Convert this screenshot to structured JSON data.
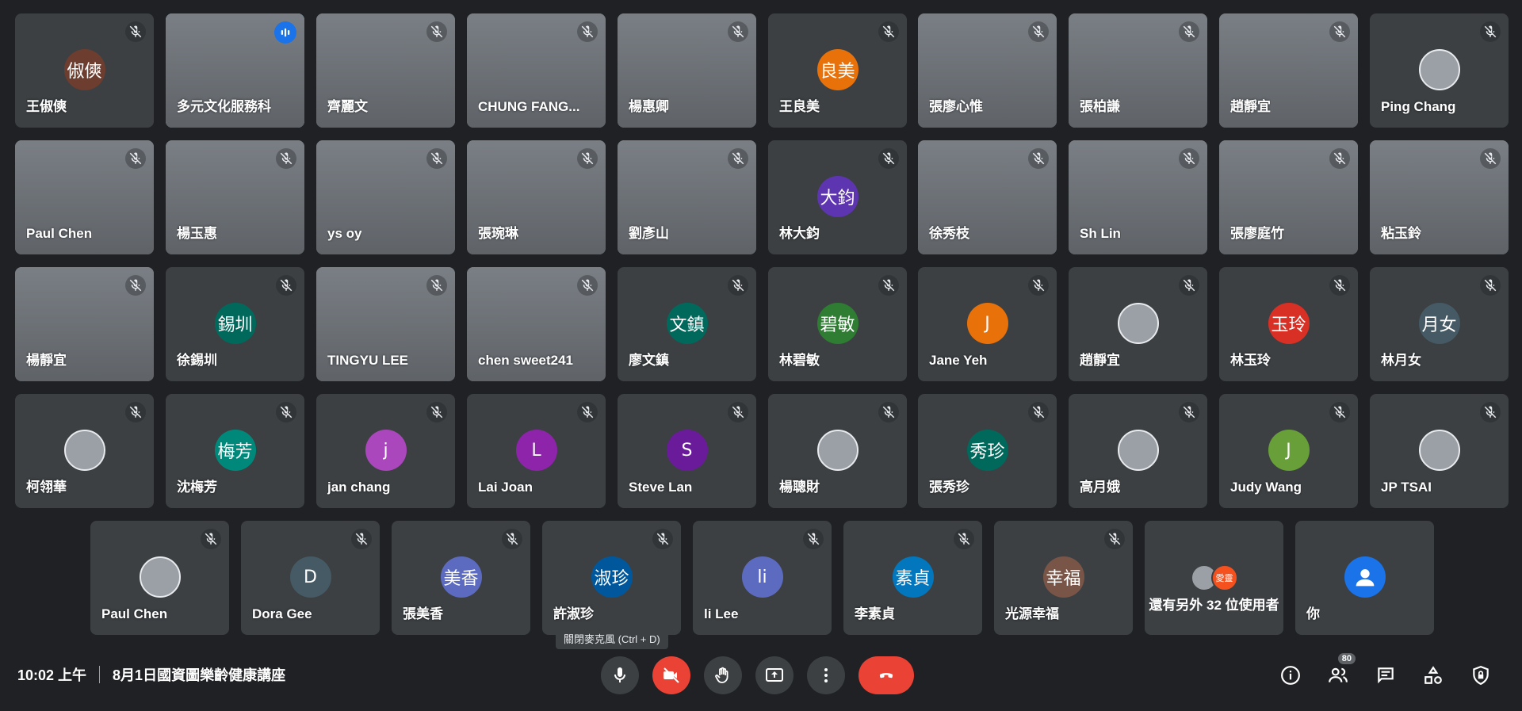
{
  "colors": {
    "background": "#202124",
    "tile": "#3c4043",
    "accent": "#8ab4f8",
    "danger": "#ea4335"
  },
  "participants": [
    {
      "name": "王俶傸",
      "avatar_text": "俶傸",
      "avatar_color": "#6d3d2f",
      "type": "initials"
    },
    {
      "name": "多元文化服務科",
      "type": "video",
      "speaking": true
    },
    {
      "name": "齊麗文",
      "type": "video"
    },
    {
      "name": "CHUNG FANG...",
      "type": "video"
    },
    {
      "name": "楊惠卿",
      "type": "video"
    },
    {
      "name": "王良美",
      "avatar_text": "良美",
      "avatar_color": "#e8710a",
      "type": "initials"
    },
    {
      "name": "張廖心惟",
      "type": "video"
    },
    {
      "name": "張柏謙",
      "type": "video"
    },
    {
      "name": "趙靜宜",
      "type": "video"
    },
    {
      "name": "Ping Chang",
      "type": "photo"
    },
    {
      "name": "Paul Chen",
      "type": "video"
    },
    {
      "name": "楊玉惠",
      "type": "video"
    },
    {
      "name": "ys oy",
      "type": "video"
    },
    {
      "name": "張琬琳",
      "type": "video"
    },
    {
      "name": "劉彥山",
      "type": "video"
    },
    {
      "name": "林大鈞",
      "avatar_text": "大鈞",
      "avatar_color": "#5e35b1",
      "type": "initials"
    },
    {
      "name": "徐秀枝",
      "type": "video"
    },
    {
      "name": "Sh Lin",
      "type": "video"
    },
    {
      "name": "張廖庭竹",
      "type": "video"
    },
    {
      "name": "粘玉鈴",
      "type": "video"
    },
    {
      "name": "楊靜宜",
      "type": "video"
    },
    {
      "name": "徐錫圳",
      "avatar_text": "錫圳",
      "avatar_color": "#00695c",
      "type": "initials"
    },
    {
      "name": "TINGYU LEE",
      "type": "video"
    },
    {
      "name": "chen sweet241",
      "type": "video"
    },
    {
      "name": "廖文鎮",
      "avatar_text": "文鎮",
      "avatar_color": "#00695c",
      "type": "initials"
    },
    {
      "name": "林碧敏",
      "avatar_text": "碧敏",
      "avatar_color": "#2e7d32",
      "type": "initials"
    },
    {
      "name": "Jane Yeh",
      "avatar_text": "J",
      "avatar_color": "#e8710a",
      "type": "initials"
    },
    {
      "name": "趙靜宜",
      "type": "photo"
    },
    {
      "name": "林玉玲",
      "avatar_text": "玉玲",
      "avatar_color": "#d93025",
      "type": "initials"
    },
    {
      "name": "林月女",
      "avatar_text": "月女",
      "avatar_color": "#455a64",
      "type": "initials"
    },
    {
      "name": "柯翎華",
      "type": "photo"
    },
    {
      "name": "沈梅芳",
      "avatar_text": "梅芳",
      "avatar_color": "#00897b",
      "type": "initials"
    },
    {
      "name": "jan chang",
      "avatar_text": "j",
      "avatar_color": "#ab47bc",
      "type": "initials"
    },
    {
      "name": "Lai Joan",
      "avatar_text": "L",
      "avatar_color": "#8e24aa",
      "type": "initials"
    },
    {
      "name": "Steve Lan",
      "avatar_text": "S",
      "avatar_color": "#6a1b9a",
      "type": "initials"
    },
    {
      "name": "楊聰財",
      "type": "photo"
    },
    {
      "name": "張秀珍",
      "avatar_text": "秀珍",
      "avatar_color": "#00695c",
      "type": "initials"
    },
    {
      "name": "高月娥",
      "type": "photo"
    },
    {
      "name": "Judy Wang",
      "avatar_text": "J",
      "avatar_color": "#689f38",
      "type": "initials"
    },
    {
      "name": "JP TSAI",
      "type": "photo"
    },
    {
      "name": "Paul Chen",
      "type": "photo"
    },
    {
      "name": "Dora Gee",
      "avatar_text": "D",
      "avatar_color": "#455a64",
      "type": "initials"
    },
    {
      "name": "張美香",
      "avatar_text": "美香",
      "avatar_color": "#5c6bc0",
      "type": "initials"
    },
    {
      "name": "許淑珍",
      "avatar_text": "淑珍",
      "avatar_color": "#01579b",
      "type": "initials"
    },
    {
      "name": "li Lee",
      "avatar_text": "li",
      "avatar_color": "#5c6bc0",
      "type": "initials"
    },
    {
      "name": "李素貞",
      "avatar_text": "素貞",
      "avatar_color": "#0277bd",
      "type": "initials"
    },
    {
      "name": "光源幸福",
      "avatar_text": "幸福",
      "avatar_color": "#795548",
      "type": "initials"
    }
  ],
  "others_tile": {
    "label": "還有另外 32 位使用者",
    "avatar_texts": [
      "",
      "愛靈"
    ]
  },
  "you_tile": {
    "name": "你"
  },
  "tooltip": "關閉麥克風 (Ctrl + D)",
  "meeting": {
    "time": "10:02 上午",
    "title": "8月1日國資圖樂齡健康講座"
  },
  "controls": {
    "mic": "microphone-icon",
    "camera": "camera-off-icon",
    "raise_hand": "raise-hand-icon",
    "present": "present-screen-icon",
    "more": "more-options-icon",
    "leave": "leave-call-icon"
  },
  "side": {
    "info": "info-icon",
    "people": "people-icon",
    "people_count": "80",
    "chat": "chat-icon",
    "activities": "activities-icon",
    "host_controls": "host-controls-icon"
  }
}
